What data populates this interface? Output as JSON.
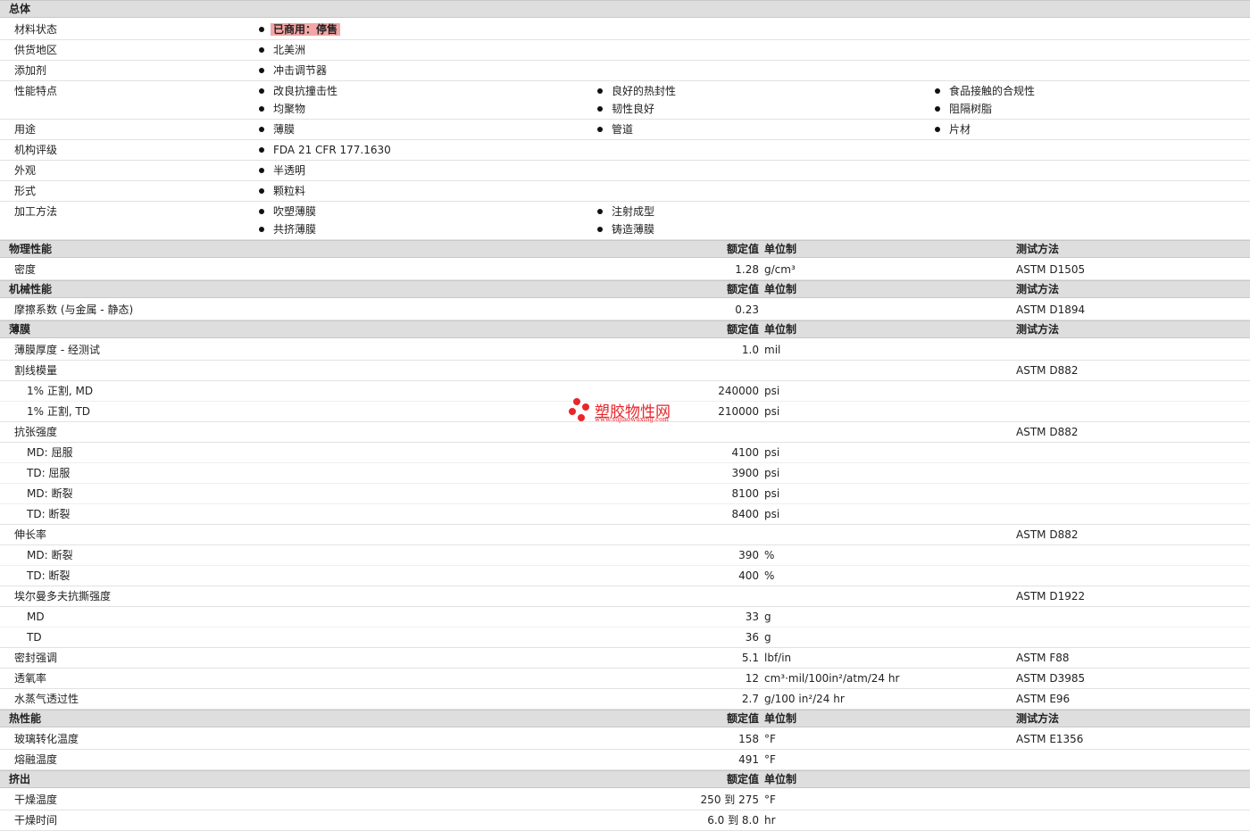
{
  "general": {
    "title": "总体",
    "rows": [
      {
        "label": "材料状态",
        "items": [
          [
            "已商用：停售"
          ]
        ],
        "badge": true
      },
      {
        "label": "供货地区",
        "items": [
          [
            "北美洲"
          ]
        ]
      },
      {
        "label": "添加剂",
        "items": [
          [
            "冲击调节器"
          ]
        ]
      },
      {
        "label": "性能特点",
        "items": [
          [
            "改良抗撞击性",
            "均聚物"
          ],
          [
            "良好的热封性",
            "韧性良好"
          ],
          [
            "食品接触的合规性",
            "阻隔树脂"
          ]
        ]
      },
      {
        "label": "用途",
        "items": [
          [
            "薄膜"
          ],
          [
            "管道"
          ],
          [
            "片材"
          ]
        ]
      },
      {
        "label": "机构评级",
        "items": [
          [
            "FDA 21 CFR 177.1630"
          ]
        ]
      },
      {
        "label": "外观",
        "items": [
          [
            "半透明"
          ]
        ]
      },
      {
        "label": "形式",
        "items": [
          [
            "颗粒料"
          ]
        ]
      },
      {
        "label": "加工方法",
        "items": [
          [
            "吹塑薄膜",
            "共挤薄膜"
          ],
          [
            "注射成型",
            "铸造薄膜"
          ]
        ]
      }
    ]
  },
  "columns": {
    "value": "额定值",
    "unit": "单位制",
    "method": "测试方法"
  },
  "sections": [
    {
      "title": "物理性能",
      "methodHeader": true,
      "rows": [
        {
          "label": "密度",
          "value": "1.28",
          "unit": "g/cm³",
          "method": "ASTM D1505"
        }
      ]
    },
    {
      "title": "机械性能",
      "methodHeader": true,
      "rows": [
        {
          "label": "摩擦系数 (与金属 - 静态)",
          "value": "0.23",
          "unit": "",
          "method": "ASTM D1894"
        }
      ]
    },
    {
      "title": "薄膜",
      "methodHeader": true,
      "rows": [
        {
          "label": "薄膜厚度 - 经测试",
          "value": "1.0",
          "unit": "mil",
          "method": ""
        },
        {
          "label": "割线模量",
          "value": "",
          "unit": "",
          "method": "ASTM D882"
        },
        {
          "label": "1% 正割, MD",
          "sub": true,
          "value": "240000",
          "unit": "psi",
          "method": "",
          "light": true
        },
        {
          "label": "1% 正割, TD",
          "sub": true,
          "value": "210000",
          "unit": "psi",
          "method": ""
        },
        {
          "label": "抗张强度",
          "value": "",
          "unit": "",
          "method": "ASTM D882"
        },
        {
          "label": "MD: 屈服",
          "sub": true,
          "value": "4100",
          "unit": "psi",
          "method": "",
          "light": true
        },
        {
          "label": "TD: 屈服",
          "sub": true,
          "value": "3900",
          "unit": "psi",
          "method": "",
          "light": true
        },
        {
          "label": "MD: 断裂",
          "sub": true,
          "value": "8100",
          "unit": "psi",
          "method": "",
          "light": true
        },
        {
          "label": "TD: 断裂",
          "sub": true,
          "value": "8400",
          "unit": "psi",
          "method": ""
        },
        {
          "label": "伸长率",
          "value": "",
          "unit": "",
          "method": "ASTM D882"
        },
        {
          "label": "MD: 断裂",
          "sub": true,
          "value": "390",
          "unit": "%",
          "method": "",
          "light": true
        },
        {
          "label": "TD: 断裂",
          "sub": true,
          "value": "400",
          "unit": "%",
          "method": ""
        },
        {
          "label": "埃尔曼多夫抗撕强度",
          "value": "",
          "unit": "",
          "method": "ASTM D1922"
        },
        {
          "label": "MD",
          "sub": true,
          "value": "33",
          "unit": "g",
          "method": "",
          "light": true
        },
        {
          "label": "TD",
          "sub": true,
          "value": "36",
          "unit": "g",
          "method": ""
        },
        {
          "label": "密封强调",
          "value": "5.1",
          "unit": "lbf/in",
          "method": "ASTM F88"
        },
        {
          "label": "透氧率",
          "value": "12",
          "unit": "cm³·mil/100in²/atm/24 hr",
          "method": "ASTM D3985"
        },
        {
          "label": "水蒸气透过性",
          "value": "2.7",
          "unit": "g/100 in²/24 hr",
          "method": "ASTM E96"
        }
      ]
    },
    {
      "title": "热性能",
      "methodHeader": true,
      "rows": [
        {
          "label": "玻璃转化温度",
          "value": "158",
          "unit": "°F",
          "method": "ASTM E1356"
        },
        {
          "label": "熔融温度",
          "value": "491",
          "unit": "°F",
          "method": ""
        }
      ]
    },
    {
      "title": "挤出",
      "methodHeader": false,
      "rows": [
        {
          "label": "干燥温度",
          "value": "250 到  275",
          "unit": "°F",
          "method": ""
        },
        {
          "label": "干燥时间",
          "value": "6.0 到  8.0",
          "unit": "hr",
          "method": ""
        }
      ]
    }
  ],
  "watermark": {
    "title": "塑胶物性网",
    "url": "www.sujiaowuxing.com",
    "color": "#e8262b"
  }
}
